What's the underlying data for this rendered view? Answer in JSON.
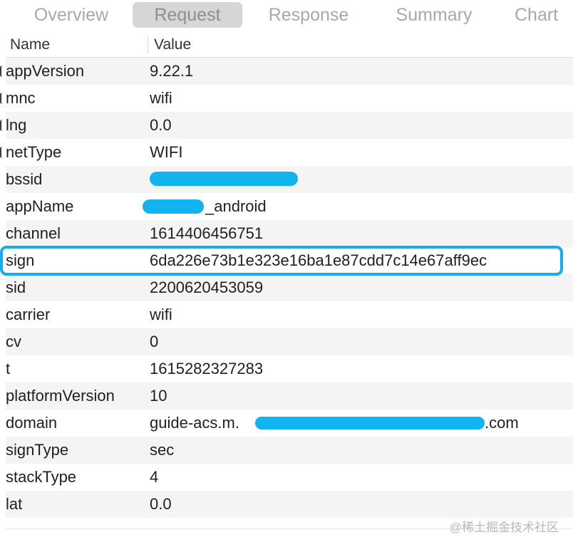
{
  "tabs": [
    {
      "label": "Overview",
      "active": false
    },
    {
      "label": "Request",
      "active": true
    },
    {
      "label": "Response",
      "active": false
    },
    {
      "label": "Summary",
      "active": false
    },
    {
      "label": "Chart",
      "active": false
    }
  ],
  "table": {
    "headers": {
      "name": "Name",
      "value": "Value"
    },
    "rows": [
      {
        "name": "appVersion",
        "value": "9.22.1"
      },
      {
        "name": "mnc",
        "value": "wifi"
      },
      {
        "name": "lng",
        "value": "0.0"
      },
      {
        "name": "netType",
        "value": "WIFI"
      },
      {
        "name": "bssid",
        "value": ""
      },
      {
        "name": "appName",
        "value": "_android"
      },
      {
        "name": "channel",
        "value": "1614406456751"
      },
      {
        "name": "sign",
        "value": "6da226e73b1e323e16ba1e87cdd7c14e67aff9ec",
        "highlighted": true
      },
      {
        "name": "sid",
        "value": "2200620453059"
      },
      {
        "name": "carrier",
        "value": "wifi"
      },
      {
        "name": "cv",
        "value": "0"
      },
      {
        "name": "t",
        "value": "1615282327283"
      },
      {
        "name": "platformVersion",
        "value": "10"
      },
      {
        "name": "domain",
        "value": "guide-acs.m.",
        "value_suffix": ".com"
      },
      {
        "name": "signType",
        "value": "sec"
      },
      {
        "name": "stackType",
        "value": "4"
      },
      {
        "name": "lat",
        "value": "0.0"
      }
    ]
  },
  "watermark": "@稀土掘金技术社区",
  "colors": {
    "highlight": "#14aef0",
    "redaction": "#12b4f0",
    "active_tab_bg": "#d6d6d6"
  }
}
